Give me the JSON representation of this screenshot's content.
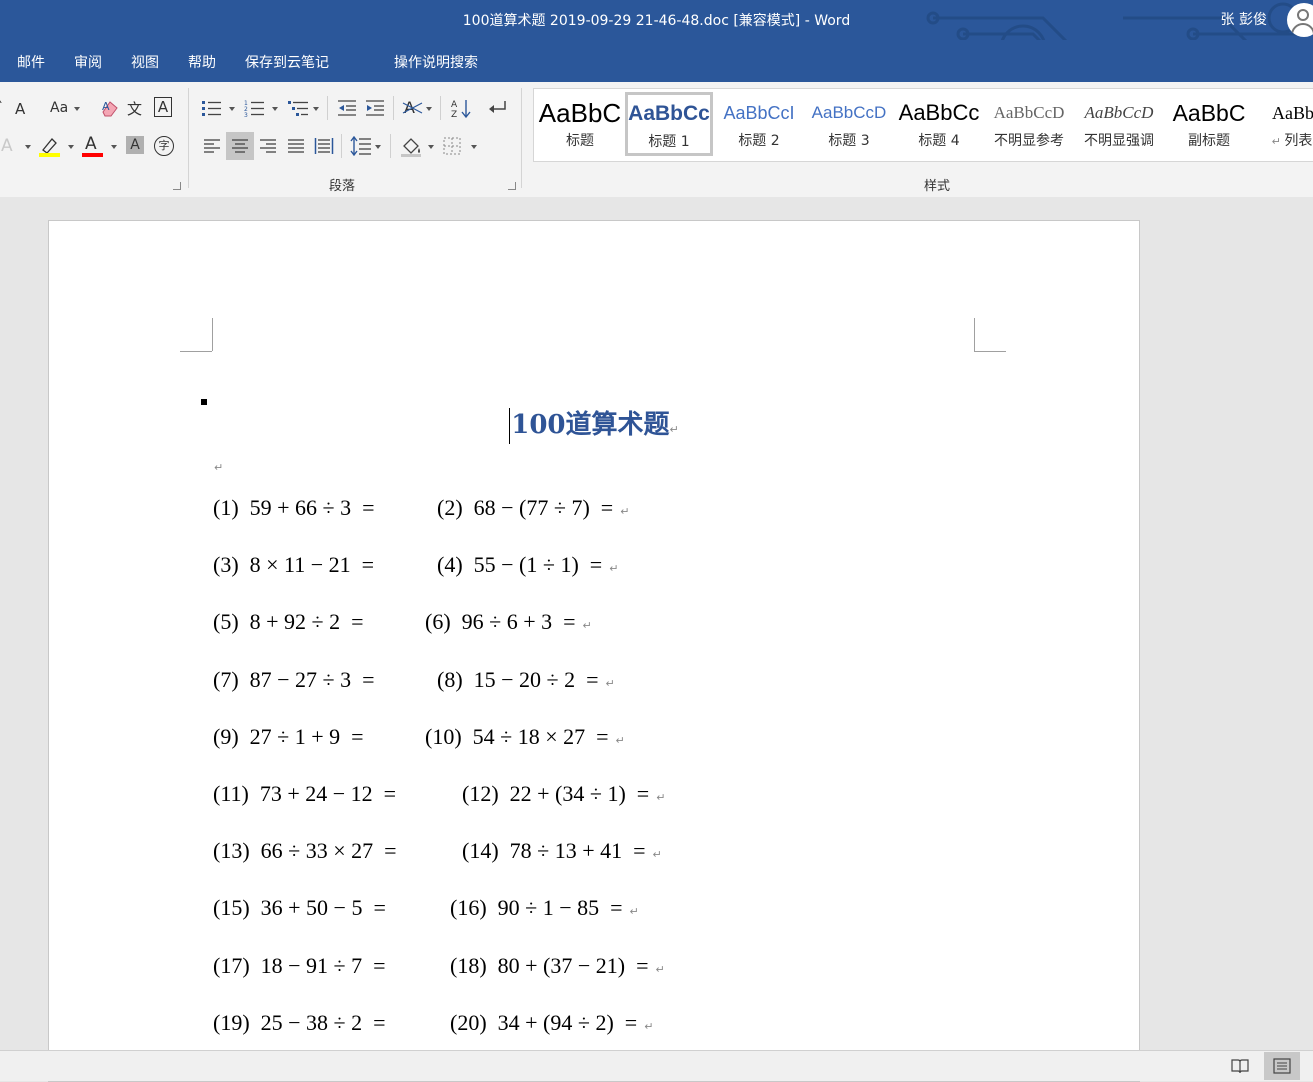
{
  "window": {
    "title": "100道算术题 2019-09-29 21-46-48.doc [兼容模式]  -  Word",
    "user": "张 彭俊"
  },
  "menu": [
    "邮件",
    "审阅",
    "视图",
    "帮助",
    "保存到云笔记",
    "操作说明搜索"
  ],
  "ribbon": {
    "groups": {
      "paragraph": "段落",
      "styles": "样式"
    },
    "font_buttons": {
      "change_case": "Aa",
      "shrink_font": "A",
      "phonetic": "文",
      "char_border": "A",
      "text_effect": "A",
      "font_color": "A",
      "char_shading": "A",
      "enclose_char": "字"
    },
    "colors": {
      "highlight": "#ffff00",
      "font_color": "#ff0000",
      "accent": "#2b579a",
      "heading": "#2f5496"
    },
    "styles": [
      {
        "sample": "AaBbC",
        "label": "标题"
      },
      {
        "sample": "AaBbCc",
        "label": "标题 1"
      },
      {
        "sample": "AaBbCcI",
        "label": "标题 2"
      },
      {
        "sample": "AaBbCcD",
        "label": "标题 3"
      },
      {
        "sample": "AaBbCc",
        "label": "标题 4"
      },
      {
        "sample": "AaBbCcD",
        "label": "不明显参考"
      },
      {
        "sample": "AaBbCcD",
        "label": "不明显强调"
      },
      {
        "sample": "AaBbC",
        "label": "副标题"
      },
      {
        "sample": "AaBbC",
        "label": "列表段"
      }
    ]
  },
  "document": {
    "heading": "100道算术题",
    "problems": [
      [
        "(1)  59 + 66 ÷ 3  =",
        "(2)  68 − (77 ÷ 7)  ="
      ],
      [
        "(3)  8 × 11 − 21  =",
        "(4)  55 − (1 ÷ 1)  ="
      ],
      [
        "(5)  8 + 92 ÷ 2  =",
        "(6)  96 ÷ 6 + 3  ="
      ],
      [
        "(7)  87 − 27 ÷ 3  =",
        "(8)  15 − 20 ÷ 2  ="
      ],
      [
        "(9)  27 ÷ 1 + 9  =",
        "(10)  54 ÷ 18 × 27  ="
      ],
      [
        "(11)  73 + 24 − 12  =",
        "(12)  22 + (34 ÷ 1)  ="
      ],
      [
        "(13)  66 ÷ 33 × 27  =",
        "(14)  78 ÷ 13 + 41  ="
      ],
      [
        "(15)  36 + 50 − 5  =",
        "(16)  90 ÷ 1 − 85  ="
      ],
      [
        "(17)  18 − 91 ÷ 7  =",
        "(18)  80 + (37 − 21)  ="
      ],
      [
        "(19)  25 − 38 ÷ 2  =",
        "(20)  34 + (94 ÷ 2)  ="
      ]
    ]
  },
  "icons": [
    "change-case-icon",
    "clear-format-icon",
    "phonetic-guide-icon",
    "char-border-icon",
    "text-effect-icon",
    "highlight-icon",
    "font-color-icon",
    "char-shading-icon",
    "enclose-char-icon",
    "bullets-icon",
    "numbering-icon",
    "multilevel-list-icon",
    "decrease-indent-icon",
    "increase-indent-icon",
    "chinese-layout-icon",
    "sort-icon",
    "show-marks-icon",
    "align-left-icon",
    "center-icon",
    "align-right-icon",
    "justify-icon",
    "distributed-icon",
    "line-spacing-icon",
    "shading-icon",
    "borders-icon",
    "read-mode-icon",
    "print-layout-icon"
  ]
}
